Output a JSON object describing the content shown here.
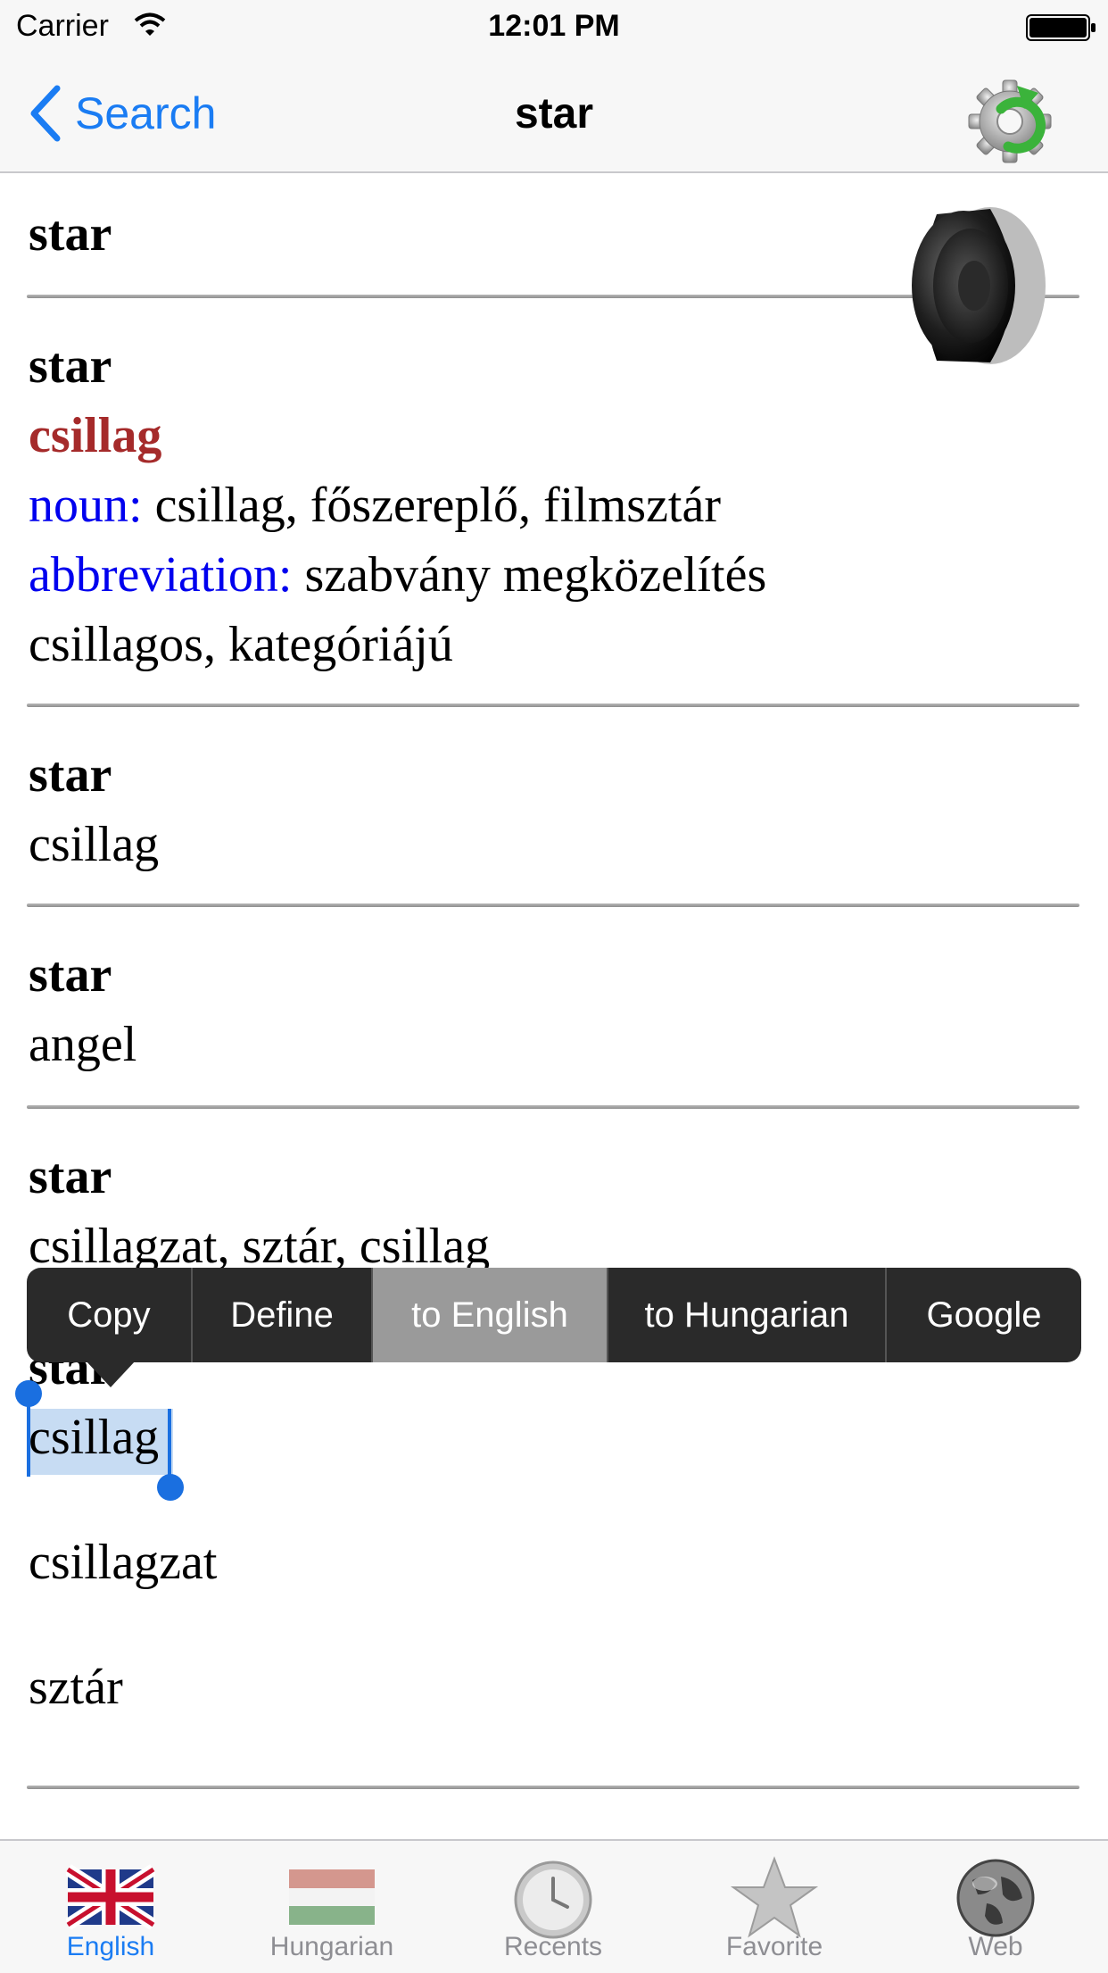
{
  "status_bar": {
    "carrier": "Carrier",
    "time": "12:01 PM"
  },
  "nav": {
    "back_label": "Search",
    "title": "star"
  },
  "entries": [
    {
      "headword": "star"
    },
    {
      "headword": "star",
      "translation": "csillag",
      "noun_label": "noun:",
      "noun_text": " csillag, főszereplő, filmsztár",
      "abbr_label": "abbreviation:",
      "abbr_text": " szabvány megközelítés",
      "extra": "csillagos, kategóriájú"
    },
    {
      "headword": "star",
      "translation": "csillag"
    },
    {
      "headword": "star",
      "translation": "angel"
    },
    {
      "headword": "star",
      "translation": "csillagzat, sztár, csillag"
    },
    {
      "headword": "star",
      "translation": "csillag",
      "extra1": "csillagzat",
      "extra2": "sztár"
    }
  ],
  "edit_menu": {
    "items": [
      "Copy",
      "Define",
      "to English",
      "to Hungarian",
      "Google"
    ],
    "active_index": 2
  },
  "tabs": [
    {
      "label": "English",
      "icon": "uk-flag-icon",
      "selected": true
    },
    {
      "label": "Hungarian",
      "icon": "hungary-flag-icon",
      "selected": false
    },
    {
      "label": "Recents",
      "icon": "clock-icon",
      "selected": false
    },
    {
      "label": "Favorite",
      "icon": "star-icon",
      "selected": false
    },
    {
      "label": "Web",
      "icon": "globe-icon",
      "selected": false
    }
  ],
  "colors": {
    "accent": "#1a7cf3",
    "translation_red": "#a52a2a",
    "pos_blue": "#0000ee",
    "selection": "#c7dcf3"
  }
}
